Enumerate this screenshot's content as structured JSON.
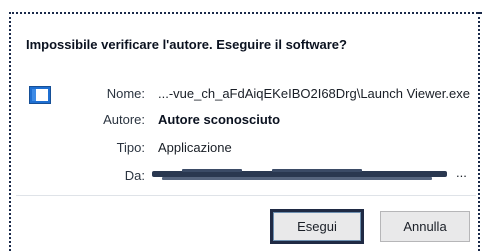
{
  "dialog": {
    "heading": "Impossibile verificare l'autore. Eseguire il software?",
    "icon": "application-window-icon",
    "fields": {
      "name_label": "Nome:",
      "name_value": "...-vue_ch_aFdAiqEKeIBO2I68Drg\\Launch Viewer.exe",
      "publisher_label": "Autore:",
      "publisher_value": "Autore sconosciuto",
      "type_label": "Tipo:",
      "type_value": "Applicazione",
      "from_label": "Da:",
      "from_value_trailing": "..."
    },
    "buttons": {
      "run_label": "Esegui",
      "cancel_label": "Annulla"
    },
    "colors": {
      "focus_border": "#1f2a44",
      "button_bg": "#e9e9ea",
      "icon_blue": "#1f6fd1"
    }
  }
}
